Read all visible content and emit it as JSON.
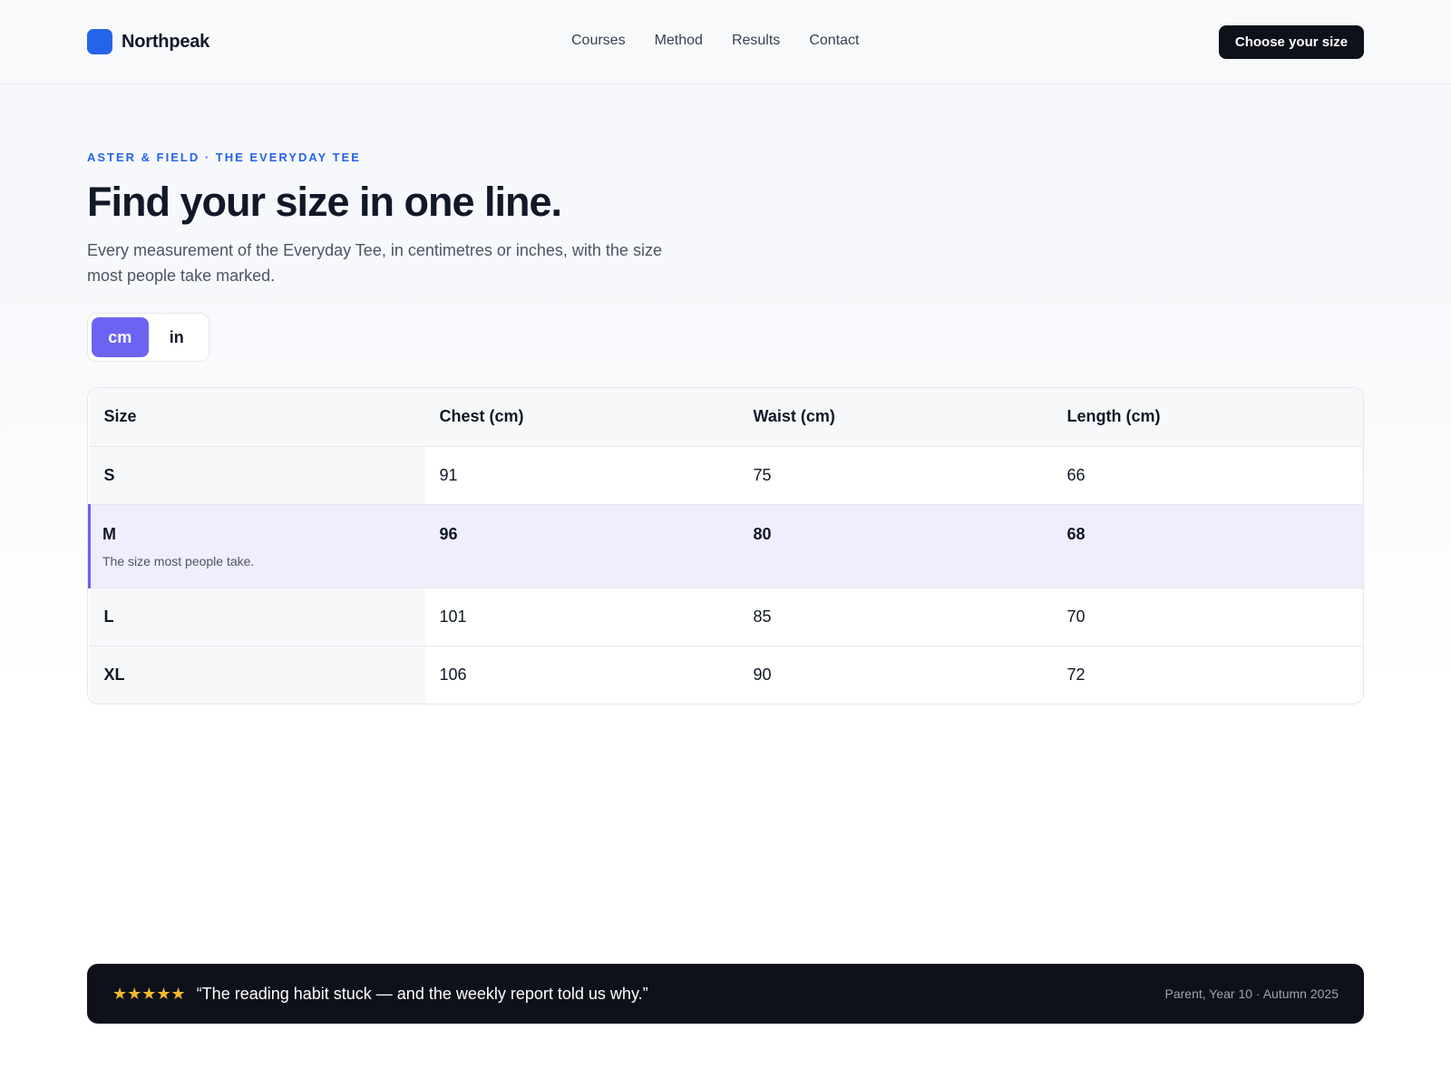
{
  "header": {
    "brand": "Northpeak",
    "nav": [
      "Courses",
      "Method",
      "Results",
      "Contact"
    ],
    "cta": "Choose your size"
  },
  "hero": {
    "eyebrow": "ASTER & FIELD · THE EVERYDAY TEE",
    "title": "Find your size in one line.",
    "subtitle": "Every measurement of the Everyday Tee, in centimetres or inches, with the size most people take marked."
  },
  "units": {
    "options": [
      "cm",
      "in"
    ],
    "selected": "cm"
  },
  "table": {
    "headers": [
      "Size",
      "Chest (cm)",
      "Waist (cm)",
      "Length (cm)"
    ],
    "rows": [
      {
        "size": "S",
        "chest": "91",
        "waist": "75",
        "length": "66"
      },
      {
        "size": "M",
        "note": "The size most people take.",
        "chest": "96",
        "waist": "80",
        "length": "68"
      },
      {
        "size": "L",
        "chest": "101",
        "waist": "85",
        "length": "70"
      },
      {
        "size": "XL",
        "chest": "106",
        "waist": "90",
        "length": "72"
      }
    ]
  },
  "testimonial": {
    "stars": "★★★★★",
    "quote": "“The reading habit stuck — and the weekly report told us why.”",
    "attribution": "Parent, Year 10 · Autumn 2025"
  },
  "colors": {
    "brand": "#2563eb",
    "accent": "#6c63f2",
    "dark": "#0f111a",
    "star": "#f5b82e"
  }
}
